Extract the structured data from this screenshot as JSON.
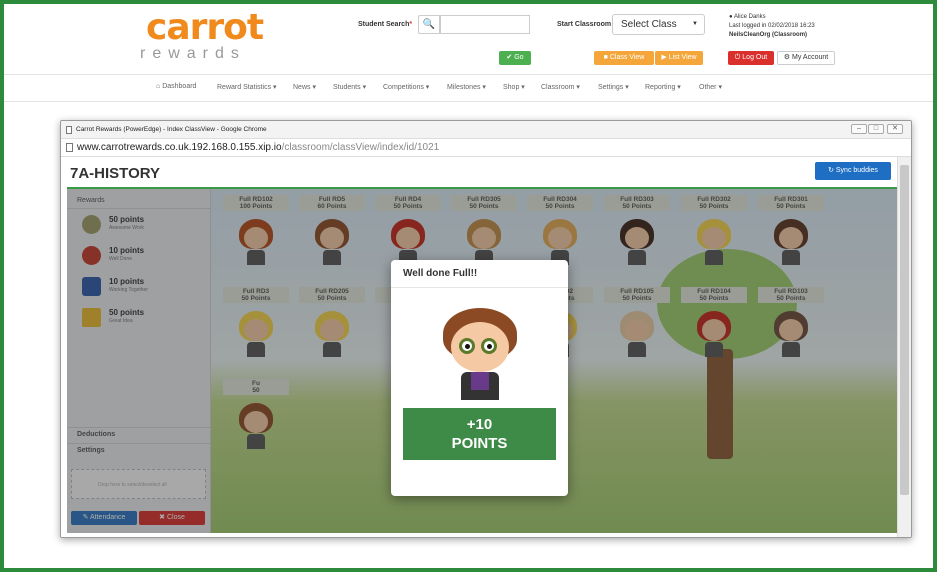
{
  "logo": {
    "main": "carrot",
    "sub": "rewards"
  },
  "header": {
    "student_search_label": "Student Search",
    "student_search_required": "*",
    "search_placeholder": "",
    "start_classroom_label": "Start Classroom",
    "select_class": "Select Class",
    "user_name": "Alice Danks",
    "last_logged": "Last logged in 02/02/2018 16:23",
    "org": "NeilsCleanOrg (Classroom)",
    "go": "Go",
    "class_view": "Class View",
    "list_view": "List View",
    "log_out": "Log Out",
    "my_account": "My Account"
  },
  "nav": [
    {
      "label": "Dashboard"
    },
    {
      "label": "Reward Statistics ▾"
    },
    {
      "label": "News ▾"
    },
    {
      "label": "Students ▾"
    },
    {
      "label": "Competitions ▾"
    },
    {
      "label": "Milestones ▾"
    },
    {
      "label": "Shop ▾"
    },
    {
      "label": "Classroom ▾"
    },
    {
      "label": "Settings ▾"
    },
    {
      "label": "Reporting ▾"
    },
    {
      "label": "Other ▾"
    }
  ],
  "window": {
    "title": "Carrot Rewards (PowerEdge) - Index ClassView - Google Chrome",
    "url_host": "www.carrotrewards.co.uk.192.168.0.155.xip.io",
    "url_path": "/classroom/classView/index/id/1021"
  },
  "page": {
    "class_title": "7A-HISTORY",
    "sync_buddies": "Sync buddies"
  },
  "panel": {
    "rewards_header": "Rewards",
    "rewards": [
      {
        "points": "50 points",
        "desc": "Awesome Work",
        "color": "#9c9c6a"
      },
      {
        "points": "10 points",
        "desc": "Well Done",
        "color": "#c0392b"
      },
      {
        "points": "10 points",
        "desc": "Working Together",
        "color": "#2a5aa8"
      },
      {
        "points": "50 points",
        "desc": "Great Idea",
        "color": "#e8b830"
      }
    ],
    "deductions": "Deductions",
    "settings": "Settings",
    "dropzone": "Drop here to select/deselect all",
    "attendance": "Attendance",
    "close": "Close"
  },
  "students": [
    {
      "name": "Full RD102",
      "points": "100 Points",
      "hair": "#b34a1a"
    },
    {
      "name": "Full RD5",
      "points": "60 Points",
      "hair": "#8b4a23"
    },
    {
      "name": "Full RD4",
      "points": "50 Points",
      "hair": "#c0261a"
    },
    {
      "name": "Full RD305",
      "points": "50 Points",
      "hair": "#c08a45"
    },
    {
      "name": "Full RD304",
      "points": "50 Points",
      "hair": "#e0a850"
    },
    {
      "name": "Full RD303",
      "points": "50 Points",
      "hair": "#3a2418"
    },
    {
      "name": "Full RD302",
      "points": "50 Points",
      "hair": "#f2d04a"
    },
    {
      "name": "Full RD301",
      "points": "50 Points",
      "hair": "#5a3420"
    },
    {
      "name": "Full RD3",
      "points": "50 Points",
      "hair": "#f2d04a"
    },
    {
      "name": "Full RD205",
      "points": "50 Points",
      "hair": "#f2d04a"
    },
    {
      "name": "Fu",
      "points": "50",
      "hair": "#8b4a23"
    },
    {
      "name": "Full RD201",
      "points": "50 Points",
      "hair": "#c0261a"
    },
    {
      "name": "Full RD2",
      "points": "50 Points",
      "hair": "#f2d04a"
    },
    {
      "name": "Full RD105",
      "points": "50 Points",
      "hair": "#e6c8a0"
    },
    {
      "name": "Full RD104",
      "points": "50 Points",
      "hair": "#c0261a"
    },
    {
      "name": "Full RD103",
      "points": "50 Points",
      "hair": "#6a4a38"
    },
    {
      "name": "Fu",
      "points": "50",
      "hair": "#8b4a23"
    }
  ],
  "modal": {
    "title": "Well done Full!!",
    "points_value": "+10",
    "points_label": "POINTS"
  },
  "colors": {
    "brand_orange": "#f08a1c",
    "accent_green": "#3d8b47",
    "frame_green": "#2e8b3c",
    "sync_blue": "#1e6fc4"
  }
}
